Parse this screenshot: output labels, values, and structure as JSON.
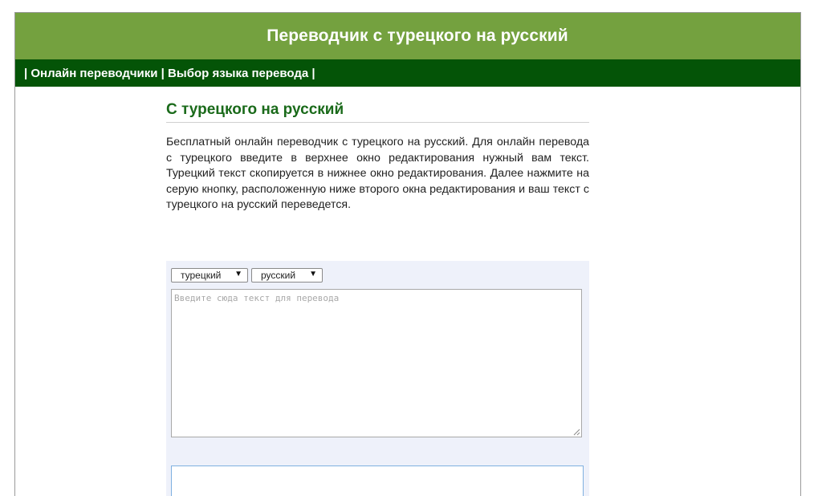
{
  "header": {
    "title": "Переводчик с турецкого на русский"
  },
  "nav": {
    "sep_start": "| ",
    "link_translators": "Онлайн переводчики",
    "sep_mid": " | ",
    "link_language": "Выбор языка перевода",
    "sep_end": " |"
  },
  "main": {
    "title": "С турецкого на русский",
    "description": "Бесплатный онлайн переводчик с турецкого на русский. Для онлайн перевода с турецкого введите в верхнее окно редактирования нужный вам текст. Турецкий текст скопируется в нижнее окно редактирования. Далее нажмите на серую кнопку, расположенную ниже второго окна редактирования и ваш текст с турецкого на русский переведется."
  },
  "translator": {
    "source_lang": "турецкий",
    "target_lang": "русский",
    "dropdown_arrow": "▼",
    "source_value": "",
    "source_placeholder": "Введите сюда текст для перевода",
    "result_value": ""
  },
  "colors": {
    "header_bg": "#74a13f",
    "nav_bg": "#045407",
    "title_color": "#1a6a1a",
    "translator_bg": "#eef1fa"
  }
}
